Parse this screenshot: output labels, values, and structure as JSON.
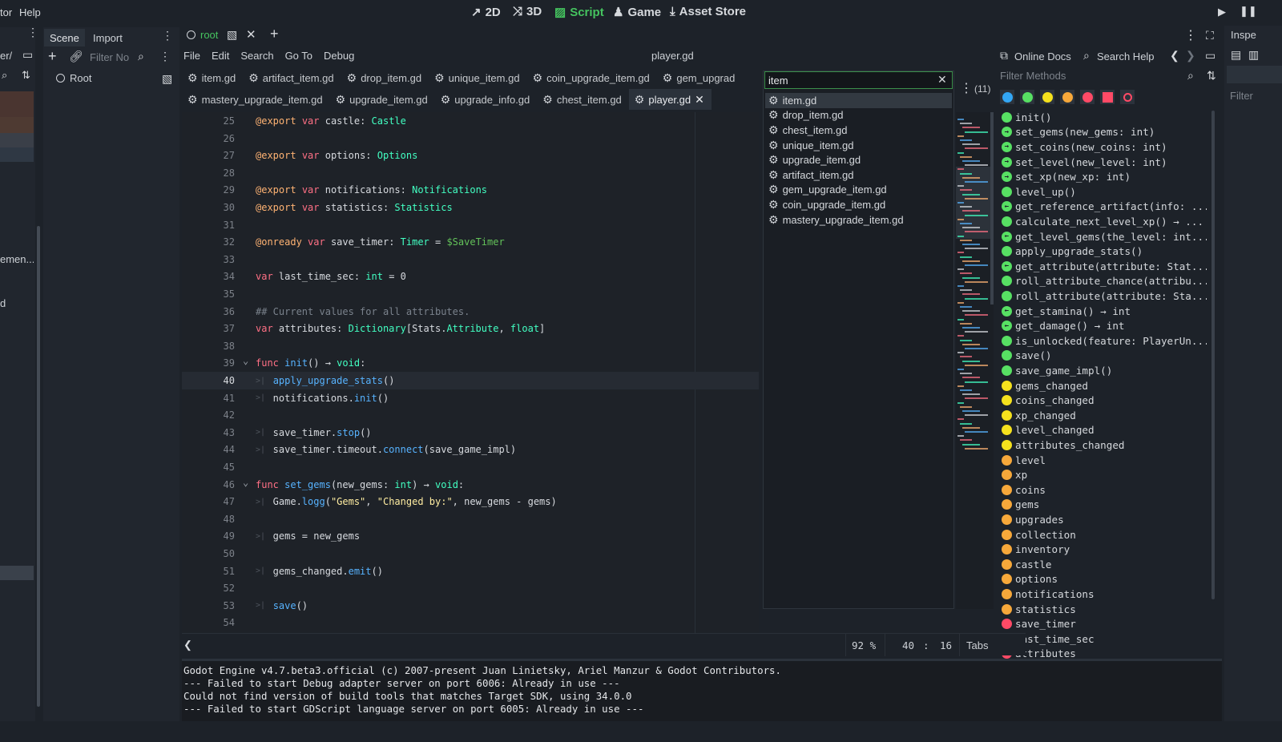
{
  "menubar": {
    "partial_item": "tor",
    "help": "Help"
  },
  "workspaces": [
    {
      "label": "2D",
      "icon": "2d-icon",
      "glyph": "↗"
    },
    {
      "label": "3D",
      "icon": "3d-icon",
      "glyph": "⤨"
    },
    {
      "label": "Script",
      "icon": "script-icon",
      "glyph": "▨",
      "active": true
    },
    {
      "label": "Game",
      "icon": "game-icon",
      "glyph": "♟"
    },
    {
      "label": "Asset Store",
      "icon": "asset-store-icon",
      "glyph": "⤓"
    }
  ],
  "left_dock": {
    "path_fragment": "er/",
    "item_fragment": "emen...",
    "item_fragment2": "d",
    "tabs": [
      "Scene",
      "Import"
    ],
    "filter_placeholder": "Filter No",
    "tree_root": "Root"
  },
  "scene_tab": {
    "name": "root"
  },
  "editor_menu": [
    "File",
    "Edit",
    "Search",
    "Go To",
    "Debug"
  ],
  "editor_title": "player.gd",
  "file_tabs_row1": [
    "item.gd",
    "artifact_item.gd",
    "drop_item.gd",
    "unique_item.gd",
    "coin_upgrade_item.gd",
    "gem_upgrad"
  ],
  "file_tabs_row2": [
    "mastery_upgrade_item.gd",
    "upgrade_item.gd",
    "upgrade_info.gd",
    "chest_item.gd",
    "player.gd"
  ],
  "quick_open": {
    "query": "item",
    "count": "(11)",
    "results": [
      "item.gd",
      "drop_item.gd",
      "chest_item.gd",
      "unique_item.gd",
      "upgrade_item.gd",
      "artifact_item.gd",
      "gem_upgrade_item.gd",
      "coin_upgrade_item.gd",
      "mastery_upgrade_item.gd"
    ],
    "selected_index": 0
  },
  "help_bar": {
    "online_docs": "Online Docs",
    "search_help": "Search Help"
  },
  "methods": {
    "filter_placeholder": "Filter Methods",
    "filter_colors": [
      "#33a7f5",
      "#57e063",
      "#f5e11d",
      "#f7a83a",
      "#ff4a66",
      "#ff4a66",
      "#ff4a66"
    ],
    "items": [
      {
        "label": "init()",
        "color": "#57e063",
        "mark": ""
      },
      {
        "label": "set_gems(new_gems: int)",
        "color": "#57e063",
        "mark": "→"
      },
      {
        "label": "set_coins(new_coins: int)",
        "color": "#57e063",
        "mark": "→"
      },
      {
        "label": "set_level(new_level: int)",
        "color": "#57e063",
        "mark": "→"
      },
      {
        "label": "set_xp(new_xp: int)",
        "color": "#57e063",
        "mark": "→"
      },
      {
        "label": "level_up()",
        "color": "#57e063",
        "mark": ""
      },
      {
        "label": "get_reference_artifact(info: ...",
        "color": "#57e063",
        "mark": "←"
      },
      {
        "label": "calculate_next_level_xp() → ...",
        "color": "#57e063",
        "mark": ""
      },
      {
        "label": "get_level_gems(the_level: int...",
        "color": "#57e063",
        "mark": "←"
      },
      {
        "label": "apply_upgrade_stats()",
        "color": "#57e063",
        "mark": ""
      },
      {
        "label": "get_attribute(attribute: Stat...",
        "color": "#57e063",
        "mark": "←"
      },
      {
        "label": "roll_attribute_chance(attribu...",
        "color": "#57e063",
        "mark": ""
      },
      {
        "label": "roll_attribute(attribute: Sta...",
        "color": "#57e063",
        "mark": ""
      },
      {
        "label": "get_stamina() → int",
        "color": "#57e063",
        "mark": "←"
      },
      {
        "label": "get_damage() → int",
        "color": "#57e063",
        "mark": "←"
      },
      {
        "label": "is_unlocked(feature: PlayerUn...",
        "color": "#57e063",
        "mark": ""
      },
      {
        "label": "save()",
        "color": "#57e063",
        "mark": ""
      },
      {
        "label": "save_game_impl()",
        "color": "#57e063",
        "mark": ""
      },
      {
        "label": "gems_changed",
        "color": "#f5e11d",
        "mark": ""
      },
      {
        "label": "coins_changed",
        "color": "#f5e11d",
        "mark": ""
      },
      {
        "label": "xp_changed",
        "color": "#f5e11d",
        "mark": ""
      },
      {
        "label": "level_changed",
        "color": "#f5e11d",
        "mark": ""
      },
      {
        "label": "attributes_changed",
        "color": "#f5e11d",
        "mark": ""
      },
      {
        "label": "level",
        "color": "#f7a83a",
        "mark": ""
      },
      {
        "label": "xp",
        "color": "#f7a83a",
        "mark": ""
      },
      {
        "label": "coins",
        "color": "#f7a83a",
        "mark": ""
      },
      {
        "label": "gems",
        "color": "#f7a83a",
        "mark": ""
      },
      {
        "label": "upgrades",
        "color": "#f7a83a",
        "mark": ""
      },
      {
        "label": "collection",
        "color": "#f7a83a",
        "mark": ""
      },
      {
        "label": "inventory",
        "color": "#f7a83a",
        "mark": ""
      },
      {
        "label": "castle",
        "color": "#f7a83a",
        "mark": ""
      },
      {
        "label": "options",
        "color": "#f7a83a",
        "mark": ""
      },
      {
        "label": "notifications",
        "color": "#f7a83a",
        "mark": ""
      },
      {
        "label": "statistics",
        "color": "#f7a83a",
        "mark": ""
      },
      {
        "label": "save_timer",
        "color": "#ff4a66",
        "mark": ""
      },
      {
        "label": "last_time_sec",
        "color": "#ff4a66",
        "mark": ""
      },
      {
        "label": "attributes",
        "color": "#ff4a66",
        "mark": ""
      }
    ]
  },
  "code": {
    "lines": [
      {
        "n": "25",
        "html": "<span class=\"an\">@export</span> <span class=\"kw\">var</span> castle: <span class=\"ty\">Castle</span>"
      },
      {
        "n": "26",
        "html": ""
      },
      {
        "n": "27",
        "html": "<span class=\"an\">@export</span> <span class=\"kw\">var</span> options: <span class=\"ty\">Options</span>"
      },
      {
        "n": "28",
        "html": ""
      },
      {
        "n": "29",
        "html": "<span class=\"an\">@export</span> <span class=\"kw\">var</span> notifications: <span class=\"ty\">Notifications</span>"
      },
      {
        "n": "30",
        "html": "<span class=\"an\">@export</span> <span class=\"kw\">var</span> statistics: <span class=\"ty\">Statistics</span>"
      },
      {
        "n": "31",
        "html": ""
      },
      {
        "n": "32",
        "html": "<span class=\"an\">@onready</span> <span class=\"kw\">var</span> save_timer: <span class=\"ty\">Timer</span> = <span class=\"an\" style=\"color:#63c259\">$SaveTimer</span>"
      },
      {
        "n": "33",
        "html": ""
      },
      {
        "n": "34",
        "html": "<span class=\"kw\">var</span> last_time_sec: <span class=\"ty\">int</span> = 0"
      },
      {
        "n": "35",
        "html": ""
      },
      {
        "n": "36",
        "html": "<span class=\"cm\">## Current values for all attributes.</span>"
      },
      {
        "n": "37",
        "html": "<span class=\"kw\">var</span> attributes: <span class=\"ty\">Dictionary</span>[Stats.<span class=\"ty\">Attribute</span>, <span class=\"ty\">float</span>]"
      },
      {
        "n": "38",
        "html": ""
      },
      {
        "n": "39",
        "html": "<span class=\"kw\">func</span> <span class=\"fn\">init</span>() → <span class=\"ty\">void</span>:",
        "fold": true
      },
      {
        "n": "40",
        "html": "   <span class=\"fn\">apply_upgrade_stats</span>()",
        "tab": true,
        "current": true
      },
      {
        "n": "41",
        "html": "   notifications.<span class=\"fn\">init</span>()",
        "tab": true
      },
      {
        "n": "42",
        "html": ""
      },
      {
        "n": "43",
        "html": "   save_timer.<span class=\"fn\">stop</span>()",
        "tab": true
      },
      {
        "n": "44",
        "html": "   save_timer.timeout.<span class=\"fn\">connect</span>(save_game_impl)",
        "tab": true
      },
      {
        "n": "45",
        "html": ""
      },
      {
        "n": "46",
        "html": "<span class=\"kw\">func</span> <span class=\"fn\">set_gems</span>(new_gems: <span class=\"ty\">int</span>) → <span class=\"ty\">void</span>:",
        "fold": true
      },
      {
        "n": "47",
        "html": "   Game.<span class=\"fn\">logg</span>(<span class=\"str\">\"Gems\"</span>, <span class=\"str\">\"Changed by:\"</span>, new_gems - gems)",
        "tab": true
      },
      {
        "n": "48",
        "html": ""
      },
      {
        "n": "49",
        "html": "   gems = new_gems",
        "tab": true
      },
      {
        "n": "50",
        "html": ""
      },
      {
        "n": "51",
        "html": "   gems_changed.<span class=\"fn\">emit</span>()",
        "tab": true
      },
      {
        "n": "52",
        "html": ""
      },
      {
        "n": "53",
        "html": "   <span class=\"fn\">save</span>()",
        "tab": true
      },
      {
        "n": "54",
        "html": ""
      }
    ]
  },
  "status_bar": {
    "zoom": "92 %",
    "line": "40",
    "sep": ":",
    "col": "16",
    "indent": "Tabs"
  },
  "output": [
    "Godot Engine v4.7.beta3.official (c) 2007-present Juan Linietsky, Ariel Manzur & Godot Contributors.",
    "--- Failed to start Debug adapter server on port 6006: Already in use ---",
    "Could not find version of build tools that matches Target SDK, using 34.0.0",
    "--- Failed to start GDScript language server on port 6005: Already in use ---"
  ],
  "inspector": {
    "title": "Inspe",
    "filter": "Filter"
  }
}
